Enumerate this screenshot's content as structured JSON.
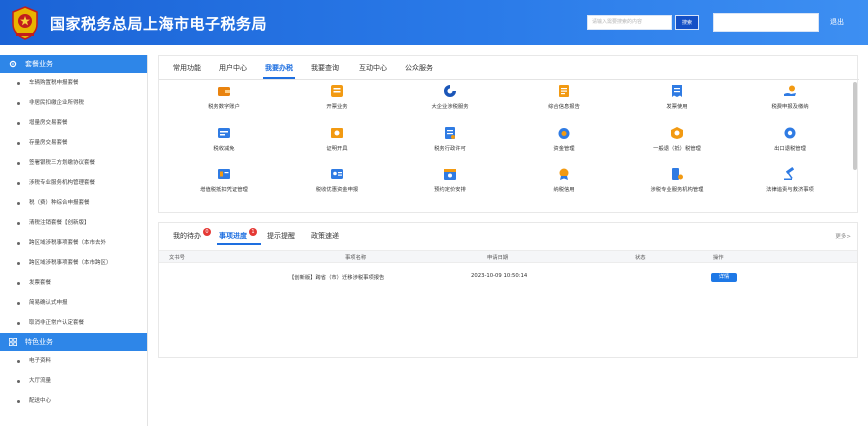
{
  "header": {
    "title": "国家税务总局上海市电子税务局",
    "search_placeholder": "请输入需要搜索的内容",
    "search_label": "搜索",
    "logout_label": "退出",
    "bg_color": "#1b63d6"
  },
  "sidebar": {
    "section1_title": "套餐业务",
    "section1_items": [
      "车辆购置税申报套餐",
      "非居民扣缴企业所得税",
      "增量房交易套餐",
      "存量房交易套餐",
      "签署银税三方划缴协议套餐",
      "涉税专业服务机构管理套餐",
      "税（费）种综合申报套餐",
      "清税注销套餐【创新版】",
      "跨区域涉税事项套餐（本市去外",
      "跨区域涉税事项套餐（本市跨区）",
      "发票套餐",
      "简易确认式申报",
      "取消非正常户认定套餐"
    ],
    "section2_title": "特色业务",
    "section2_items": [
      "电子资料",
      "大厅流量",
      "配送中心"
    ],
    "accent_color": "#2e86e8"
  },
  "func_panel": {
    "tabs": [
      "常用功能",
      "用户中心",
      "我要办税",
      "我要查询",
      "互动中心",
      "公众服务"
    ],
    "active_tab": "我要办税",
    "items": [
      {
        "label": "税务数字账户",
        "icon": "wallet-icon"
      },
      {
        "label": "开票业务",
        "icon": "invoice-icon"
      },
      {
        "label": "大企业涉税服务",
        "icon": "corporate-logo-icon"
      },
      {
        "label": "综合信息报告",
        "icon": "report-icon"
      },
      {
        "label": "发票使用",
        "icon": "receipt-icon"
      },
      {
        "label": "税费申报及缴纳",
        "icon": "hand-coin-icon"
      },
      {
        "label": "税收减免",
        "icon": "tax-relief-icon"
      },
      {
        "label": "证明开具",
        "icon": "certificate-icon"
      },
      {
        "label": "税务行政许可",
        "icon": "permit-icon"
      },
      {
        "label": "资金管理",
        "icon": "money-bag-icon"
      },
      {
        "label": "一般退（抵）税管理",
        "icon": "refund-icon"
      },
      {
        "label": "出口退税管理",
        "icon": "export-gear-icon"
      },
      {
        "label": "增值税抵扣凭证管理",
        "icon": "voucher-icon"
      },
      {
        "label": "税收优惠资金申报",
        "icon": "id-card-icon"
      },
      {
        "label": "预约定价安排",
        "icon": "calendar-icon"
      },
      {
        "label": "纳税信用",
        "icon": "medal-icon"
      },
      {
        "label": "涉税专业服务机构管理",
        "icon": "agency-icon"
      },
      {
        "label": "法律追责与救济事项",
        "icon": "gavel-icon"
      }
    ]
  },
  "task_panel": {
    "tabs": [
      {
        "label": "我的待办",
        "badge": "0"
      },
      {
        "label": "事项进度",
        "badge": "1"
      },
      {
        "label": "提示提醒",
        "badge": ""
      },
      {
        "label": "政策速递",
        "badge": ""
      }
    ],
    "active_tab": "事项进度",
    "more_label": "更多>",
    "columns": [
      "文书号",
      "事项名称",
      "申请日期",
      "状态",
      "操作"
    ],
    "rows": [
      {
        "doc_no": "",
        "name": "【创新版】跨省（市）迁移涉税事项报告",
        "date": "2023-10-09 10:50:14",
        "status": "",
        "action": "详情"
      }
    ]
  }
}
